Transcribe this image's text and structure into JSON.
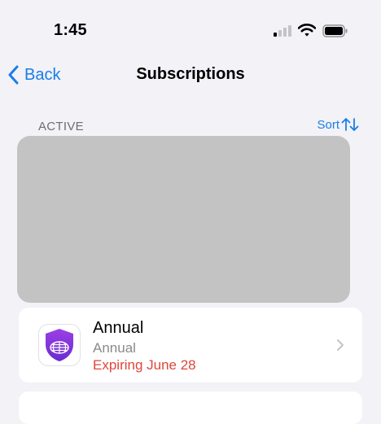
{
  "status_bar": {
    "time": "1:45",
    "icons": [
      "signal-icon",
      "wifi-icon",
      "battery-icon"
    ]
  },
  "nav": {
    "back_label": "Back",
    "title": "Subscriptions"
  },
  "section": {
    "header": "ACTIVE",
    "sort_label": "Sort"
  },
  "subscription": {
    "name": "Annual",
    "plan": "Annual",
    "expiry": "Expiring June 28",
    "icon": "shield-globe-icon"
  },
  "colors": {
    "accent": "#1a7ee8",
    "expiry": "#e0453a",
    "secondary_text": "#8a8a8e",
    "background": "#f2f2f7",
    "placeholder": "#c3c3c3",
    "icon_purple": "#8e3ee0"
  }
}
